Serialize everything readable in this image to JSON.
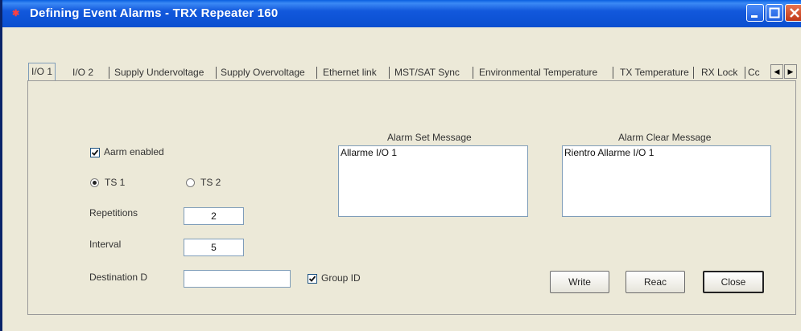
{
  "window": {
    "title": "Defining Event Alarms - TRX Repeater 160"
  },
  "tabs": [
    "I/O 1",
    "I/O 2",
    "Supply Undervoltage",
    "Supply Overvoltage",
    "Ethernet link",
    "MST/SAT Sync",
    "Environmental Temperature",
    "TX Temperature",
    "RX Lock",
    "Cc"
  ],
  "form": {
    "alarm_enabled_label": "Aarm enabled",
    "ts1_label": "TS 1",
    "ts2_label": "TS 2",
    "repetitions_label": "Repetitions",
    "repetitions_value": "2",
    "interval_label": "Interval",
    "interval_value": "5",
    "destination_label": "Destination D",
    "destination_value": "",
    "group_id_label": "Group ID"
  },
  "messages": {
    "set_title": "Alarm Set Message",
    "set_value": "Allarme I/O 1",
    "clear_title": "Alarm Clear Message",
    "clear_value": "Rientro Allarme I/O 1"
  },
  "buttons": {
    "write": "Write",
    "read": "Reac",
    "close": "Close"
  }
}
